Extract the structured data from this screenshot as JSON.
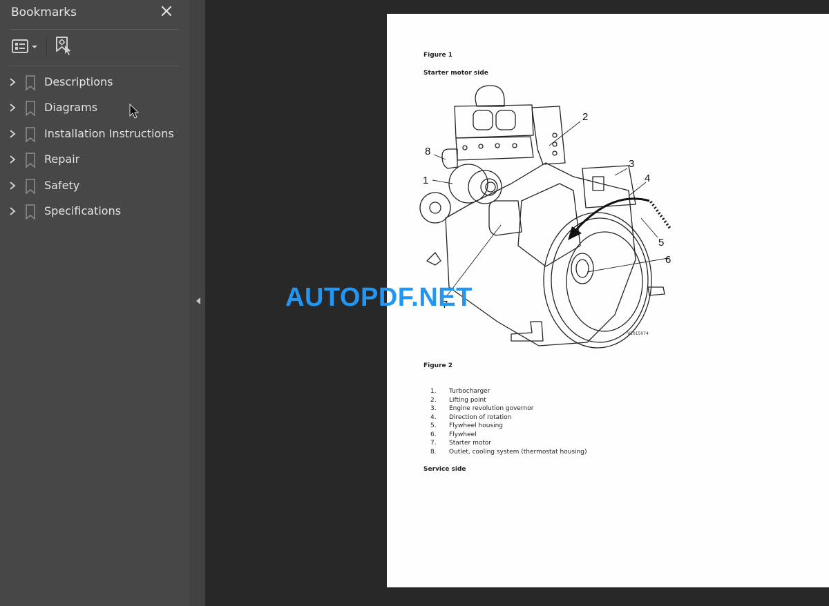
{
  "sidebar": {
    "title": "Bookmarks",
    "close_icon": "close-icon",
    "toolbar": {
      "options_icon": "list-options-icon",
      "find_icon": "find-current-bookmark-icon"
    },
    "items": [
      {
        "label": "Descriptions",
        "expanded": false
      },
      {
        "label": "Diagrams",
        "expanded": false
      },
      {
        "label": "Installation Instructions",
        "expanded": false
      },
      {
        "label": "Repair",
        "expanded": false
      },
      {
        "label": "Safety",
        "expanded": false
      },
      {
        "label": "Specifications",
        "expanded": false
      }
    ]
  },
  "splitter": {
    "icon": "collapse-left-icon"
  },
  "document": {
    "figure1_label": "Figure 1",
    "figure1_caption": "Starter motor side",
    "figure_id": "V1015074",
    "callouts": [
      "1",
      "2",
      "3",
      "4",
      "5",
      "6",
      "7",
      "8"
    ],
    "figure2_label": "Figure 2",
    "legend": [
      {
        "num": "1.",
        "text": "Turbocharger"
      },
      {
        "num": "2.",
        "text": "Lifting point"
      },
      {
        "num": "3.",
        "text": "Engine revolution governor"
      },
      {
        "num": "4.",
        "text": "Direction of rotation"
      },
      {
        "num": "5.",
        "text": "Flywheel housing"
      },
      {
        "num": "6.",
        "text": "Flywheel"
      },
      {
        "num": "7.",
        "text": "Starter motor"
      },
      {
        "num": "8.",
        "text": "Outlet, cooling system (thermostat housing)"
      }
    ],
    "next_heading": "Service side"
  },
  "watermark": {
    "text": "AUTOPDF.NET",
    "color": "#2196f3"
  }
}
